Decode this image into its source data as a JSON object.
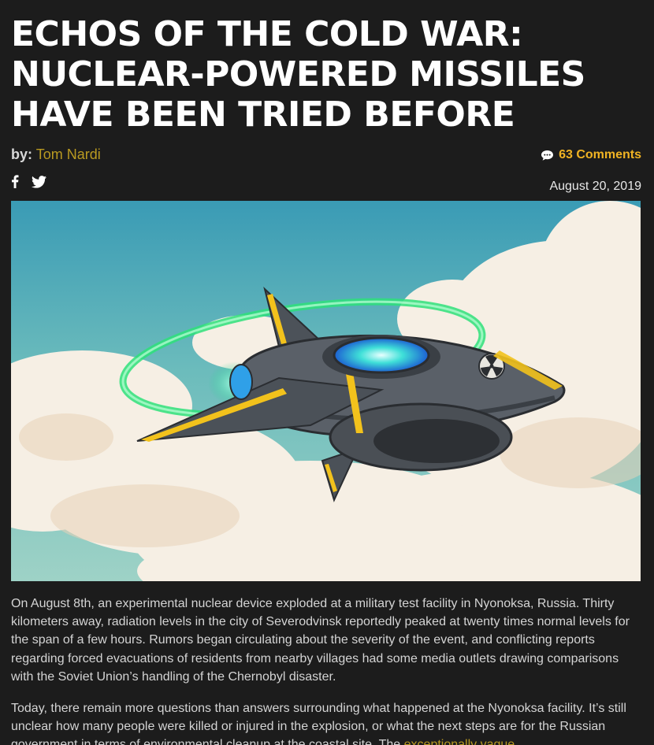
{
  "article": {
    "title_lines": [
      "ECHOS OF THE COLD WAR:",
      "NUCLEAR-POWERED MISSILES",
      "HAVE BEEN TRIED BEFORE"
    ],
    "byline_prefix": "by:",
    "author": "Tom Nardi",
    "comments_label": "63 Comments",
    "date": "August 20, 2019",
    "paragraphs": {
      "p1": "On August 8th, an experimental nuclear device exploded at a military test facility in Nyonoksa, Russia. Thirty kilometers away, radiation levels in the city of Severodvinsk reportedly peaked at twenty times normal levels for the span of a few hours. Rumors began circulating about the severity of the event, and conflicting reports regarding forced evacuations of residents from nearby villages had some media outlets drawing comparisons with the Soviet Union’s handling of the Chernobyl disaster.",
      "p2_text": "Today, there remain more questions than answers surrounding what happened at the Nyonoksa facility. It’s still unclear how many people were killed or injured in the explosion, or what the next steps are for the Russian government in terms of environmental cleanup at the coastal site. The ",
      "p2_link": "exceptionally vague"
    }
  },
  "icons": {
    "facebook": "facebook-icon",
    "twitter": "twitter-icon",
    "comment": "comment-bubble-icon"
  },
  "colors": {
    "background": "#1c1c1c",
    "accent": "#b99a21",
    "comments": "#f0b323",
    "title": "#ffffff"
  }
}
